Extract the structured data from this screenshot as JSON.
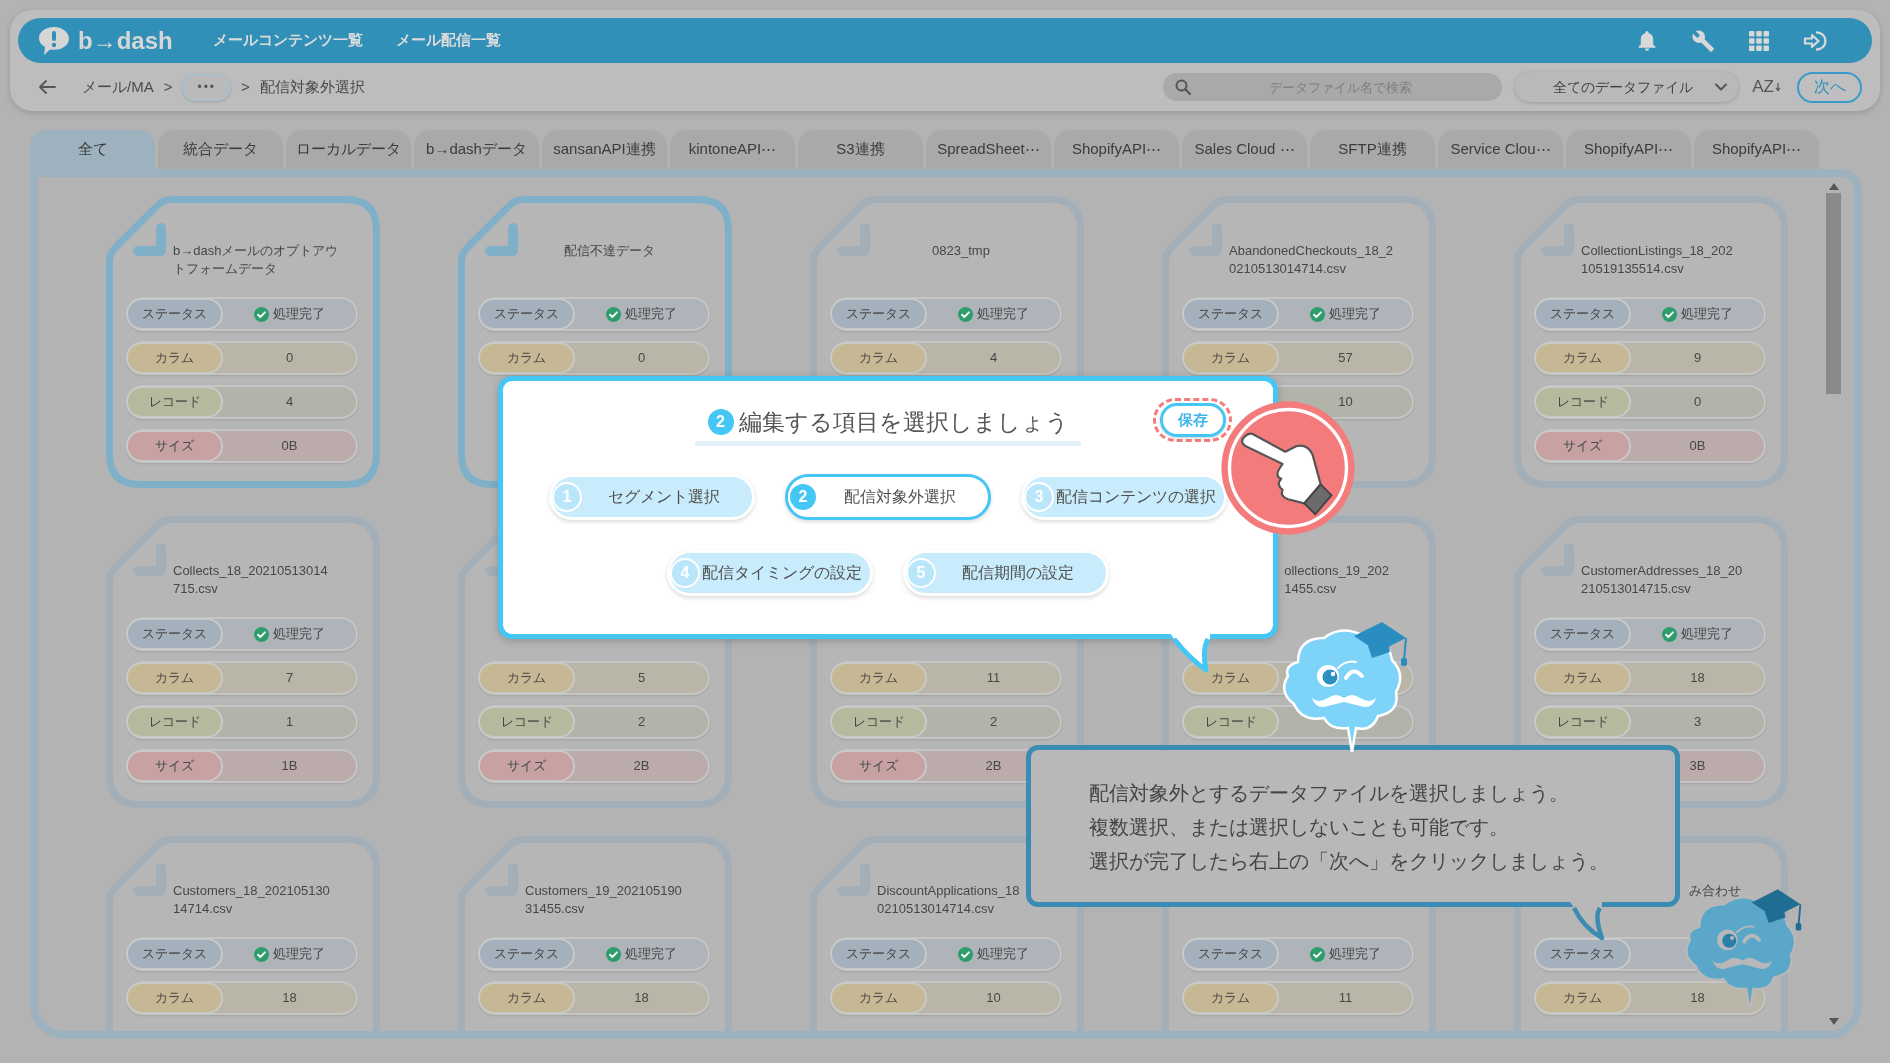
{
  "header": {
    "logo": "b→dash",
    "nav": [
      {
        "label": "メールコンテンツ一覧"
      },
      {
        "label": "メール配信一覧"
      }
    ]
  },
  "breadcrumb": [
    {
      "kind": "link",
      "text": "メール/MA"
    },
    {
      "kind": "separator",
      "text": ">"
    },
    {
      "kind": "more",
      "text": "•••"
    },
    {
      "kind": "separator",
      "text": ">"
    },
    {
      "kind": "current",
      "text": "配信対象外選択"
    }
  ],
  "toolbar": {
    "search": {
      "placeholder": "データファイル名で検索"
    },
    "filter": {
      "value": "全てのデータファイル"
    },
    "sort_label": "AZ",
    "next_button": "次へ"
  },
  "tabs": [
    {
      "label": "全て",
      "selected": true
    },
    {
      "label": "統合データ",
      "selected": false
    },
    {
      "label": "ローカルデータ",
      "selected": false
    },
    {
      "label": "b→dashデータ",
      "selected": false
    },
    {
      "label": "sansanAPI連携",
      "selected": false
    },
    {
      "label": "kintoneAPI⋯",
      "selected": false
    },
    {
      "label": "S3連携",
      "selected": false
    },
    {
      "label": "SpreadSheet⋯",
      "selected": false
    },
    {
      "label": "ShopifyAPI⋯",
      "selected": false
    },
    {
      "label": "Sales Cloud ⋯",
      "selected": false
    },
    {
      "label": "SFTP連携",
      "selected": false
    },
    {
      "label": "Service Clou⋯",
      "selected": false
    },
    {
      "label": "ShopifyAPI⋯",
      "selected": false
    },
    {
      "label": "ShopifyAPI⋯",
      "selected": false
    }
  ],
  "cards": [
    {
      "selected": true,
      "title": [
        "b→dashメールのオプトアウ",
        "トフォームデータ"
      ],
      "rows": [
        {
          "kind": "status",
          "label": "ステータス",
          "value": "処理完了"
        },
        {
          "kind": "column",
          "label": "カラム",
          "value": "0"
        },
        {
          "kind": "record",
          "label": "レコード",
          "value": "4"
        },
        {
          "kind": "size",
          "label": "サイズ",
          "value": "0B"
        }
      ]
    },
    {
      "selected": true,
      "title": [
        "配信不達データ"
      ],
      "rows": [
        {
          "kind": "status",
          "label": "ステータス",
          "value": "処理完了"
        },
        {
          "kind": "column",
          "label": "カラム",
          "value": "0"
        }
      ]
    },
    {
      "selected": false,
      "title": [
        "0823_tmp"
      ],
      "rows": [
        {
          "kind": "status",
          "label": "ステータス",
          "value": "処理完了"
        },
        {
          "kind": "column",
          "label": "カラム",
          "value": "4"
        }
      ]
    },
    {
      "selected": false,
      "title": [
        "AbandonedCheckouts_18_2",
        "0210513014714.csv"
      ],
      "rows": [
        {
          "kind": "status",
          "label": "ステータス",
          "value": "処理完了"
        },
        {
          "kind": "column",
          "label": "カラム",
          "value": "57"
        },
        {
          "kind": "record",
          "value": "10"
        }
      ]
    },
    {
      "selected": false,
      "title": [
        "CollectionListings_18_202",
        "10519135514.csv"
      ],
      "rows": [
        {
          "kind": "status",
          "label": "ステータス",
          "value": "処理完了"
        },
        {
          "kind": "column",
          "label": "カラム",
          "value": "9"
        },
        {
          "kind": "record",
          "label": "レコード",
          "value": "0"
        },
        {
          "kind": "size",
          "label": "サイズ",
          "value": "0B"
        }
      ]
    },
    {
      "selected": false,
      "title": [
        "Collects_18_20210513014",
        "715.csv"
      ],
      "rows": [
        {
          "kind": "status",
          "label": "ステータス",
          "value": "処理完了"
        },
        {
          "kind": "column",
          "label": "カラム",
          "value": "7"
        },
        {
          "kind": "record",
          "label": "レコード",
          "value": "1"
        },
        {
          "kind": "size",
          "label": "サイズ",
          "value": "1B"
        }
      ]
    },
    {
      "selected": false,
      "rows": [
        {
          "kind": "column",
          "label": "カラム",
          "value": "5"
        },
        {
          "kind": "record",
          "label": "レコード",
          "value": "2"
        },
        {
          "kind": "size",
          "label": "サイズ",
          "value": "2B"
        }
      ]
    },
    {
      "selected": false,
      "rows": [
        {
          "kind": "column",
          "label": "カラム",
          "value": "11"
        },
        {
          "kind": "record",
          "label": "レコード",
          "value": "2"
        },
        {
          "kind": "size",
          "label": "サイズ",
          "value": "2B"
        }
      ]
    },
    {
      "selected": false,
      "title": [
        "ollections_19_202",
        "1455.csv"
      ],
      "title_cut": true,
      "rows": [
        {
          "kind": "column",
          "label": "カラム"
        },
        {
          "kind": "record",
          "label": "レコード"
        }
      ]
    },
    {
      "selected": false,
      "title": [
        "CustomerAddresses_18_20",
        "210513014715.csv"
      ],
      "rows": [
        {
          "kind": "status",
          "label": "ステータス",
          "value": "処理完了"
        },
        {
          "kind": "column",
          "label": "カラム",
          "value": "18"
        },
        {
          "kind": "record",
          "label": "レコード",
          "value": "3"
        },
        {
          "kind": "size",
          "value": "3B"
        }
      ]
    },
    {
      "selected": false,
      "title": [
        "Customers_18_202105130",
        "14714.csv"
      ],
      "rows": [
        {
          "kind": "status",
          "label": "ステータス",
          "value": "処理完了"
        },
        {
          "kind": "column",
          "label": "カラム",
          "value": "18"
        }
      ]
    },
    {
      "selected": false,
      "title": [
        "Customers_19_202105190",
        "31455.csv"
      ],
      "rows": [
        {
          "kind": "status",
          "label": "ステータス",
          "value": "処理完了"
        },
        {
          "kind": "column",
          "label": "カラム",
          "value": "18"
        }
      ]
    },
    {
      "selected": false,
      "title": [
        "DiscountApplications_18",
        "0210513014714.csv"
      ],
      "rows": [
        {
          "kind": "status",
          "label": "ステータス",
          "value": "処理完了"
        },
        {
          "kind": "column",
          "label": "カラム",
          "value": "10"
        }
      ]
    },
    {
      "selected": false,
      "rows": [
        {
          "kind": "status",
          "label": "ステータス",
          "value": "処理完了"
        },
        {
          "kind": "column",
          "label": "カラム",
          "value": "11"
        }
      ]
    },
    {
      "selected": false,
      "title": [
        "み合わせ"
      ],
      "title_cut": true,
      "rows": [
        {
          "kind": "status",
          "label": "ステータス"
        },
        {
          "kind": "column",
          "label": "カラム",
          "value": "18"
        }
      ]
    }
  ],
  "guide_dialog": {
    "step_number": "2",
    "title": "編集する項目を選択しましょう",
    "save_button": "保存",
    "steps": [
      {
        "number": "1",
        "label": "セグメント選択",
        "selected": false
      },
      {
        "number": "2",
        "label": "配信対象外選択",
        "selected": true
      },
      {
        "number": "3",
        "label": "配信コンテンツの選択",
        "selected": false
      },
      {
        "number": "4",
        "label": "配信タイミングの設定",
        "selected": false
      },
      {
        "number": "5",
        "label": "配信期間の設定",
        "selected": false
      }
    ]
  },
  "guide_bubble": {
    "lines": [
      "配信対象外とするデータファイルを選択しましょう。",
      "複数選択、または選択しないことも可能です。",
      "選択が完了したら右上の「次へ」をクリックしましょう。"
    ]
  }
}
